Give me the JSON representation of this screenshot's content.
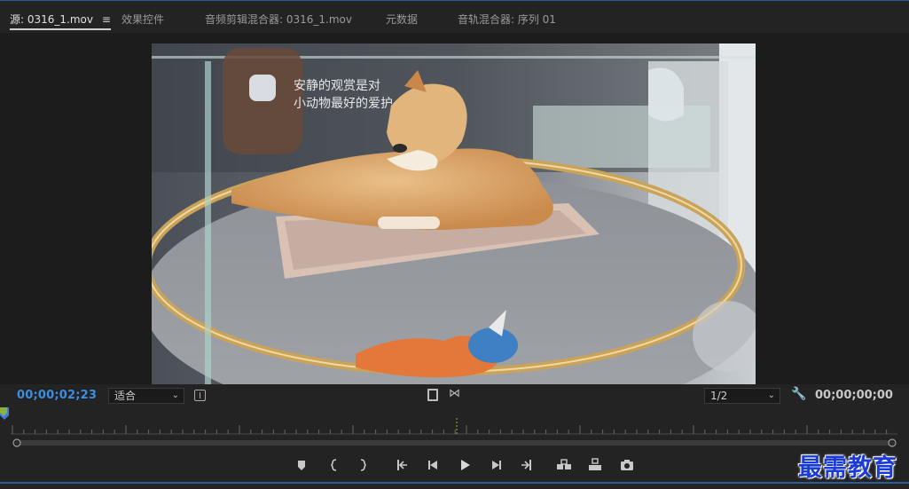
{
  "tabs": [
    {
      "label": "源: 0316_1.mov",
      "active": true
    },
    {
      "label": "效果控件",
      "active": false
    },
    {
      "label": "音频剪辑混合器: 0316_1.mov",
      "active": false
    },
    {
      "label": "元数据",
      "active": false
    },
    {
      "label": "音轨混合器: 序列 01",
      "active": false
    }
  ],
  "tab_menu_icon": "≡",
  "overlay_text": {
    "line1": "安静的观赏是对",
    "line2": "小动物最好的爱护"
  },
  "controls": {
    "timecode_in": "00;00;02;23",
    "fit_value": "适合",
    "resolution_value": "1/2",
    "timecode_duration": "00;00;00;00"
  },
  "transport_icons": [
    "marker-icon",
    "mark-in-icon",
    "mark-out-icon",
    "go-to-in-icon",
    "step-back-icon",
    "play-icon",
    "step-forward-icon",
    "go-to-out-icon",
    "insert-icon",
    "overwrite-icon",
    "export-frame-icon"
  ],
  "watermark": "最需教育",
  "colors": {
    "accent_blue": "#3a8ee6",
    "marker_green": "#8fb33a",
    "playhead_blue": "#3a7fe0"
  }
}
